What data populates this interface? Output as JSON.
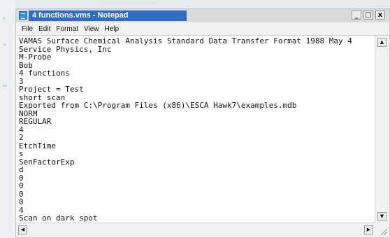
{
  "window": {
    "title": "4 functions.vms - Notepad",
    "buttons": {
      "minimize": "_",
      "maximize": "□",
      "close": "x"
    }
  },
  "menu": [
    "File",
    "Edit",
    "Format",
    "View",
    "Help"
  ],
  "document": {
    "lines": [
      "VAMAS Surface Chemical Analysis Standard Data Transfer Format 1988 May 4",
      "Service Physics, Inc",
      "M-Probe",
      "Bob",
      "4 functions",
      "3",
      "Project = Test",
      "short scan",
      "Exported from C:\\Program Files (x86)\\ESCA Hawk7\\examples.mdb",
      "NORM",
      "REGULAR",
      "4",
      "2",
      "EtchTime",
      "s",
      "SenFactorExp",
      "d",
      "0",
      "0",
      "0",
      "0",
      "4",
      "Scan on dark spot"
    ]
  },
  "colors": {
    "title_highlight": "#2f6cc2",
    "text": "#141414",
    "editor_bg": "#ffffff"
  }
}
